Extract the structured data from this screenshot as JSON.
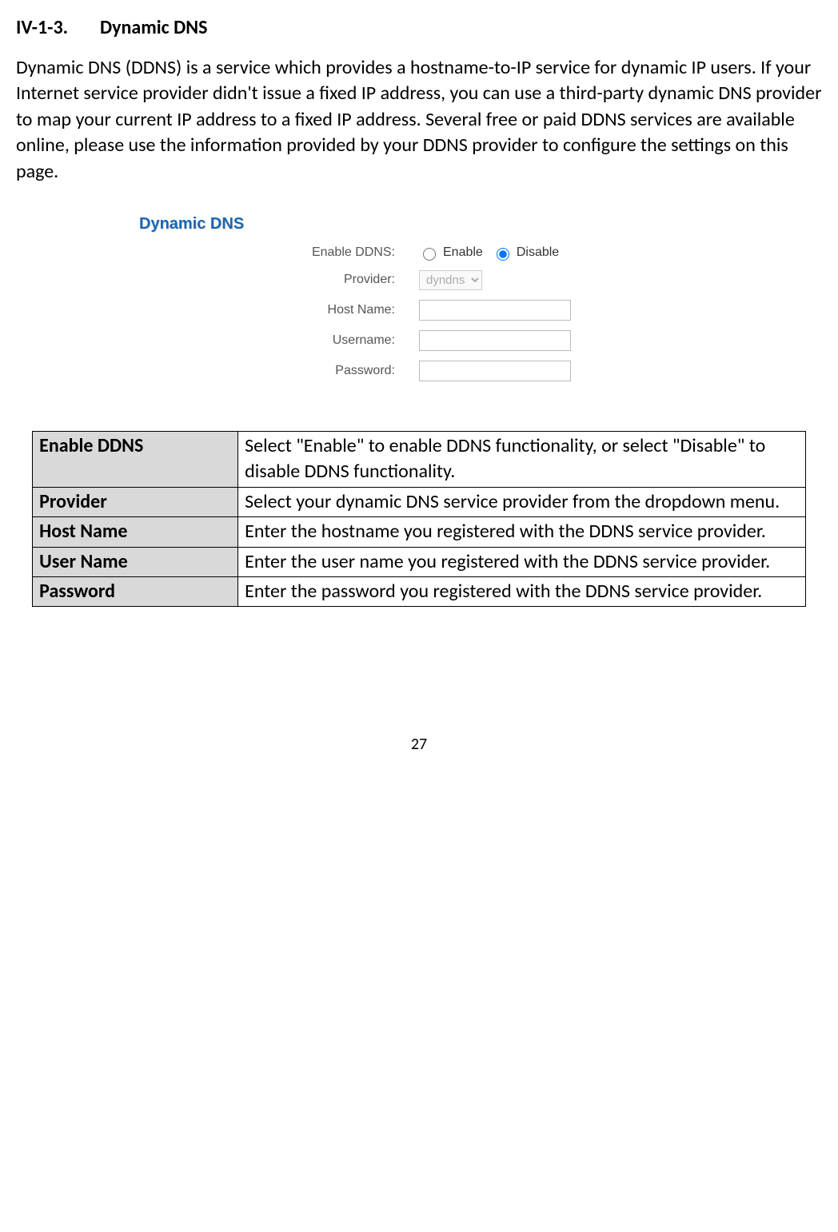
{
  "heading": {
    "number": "IV-1-3.",
    "title": "Dynamic DNS"
  },
  "intro": "Dynamic DNS (DDNS) is a service which provides a hostname-to-IP service for dynamic IP users. If your Internet service provider didn't issue a fixed IP address, you can use a third-party dynamic DNS provider to map your current IP address to a fixed IP address. Several free or paid DDNS services are available online, please use the information provided by your DDNS provider to configure the settings on this page.",
  "form": {
    "title": "Dynamic DNS",
    "labels": {
      "enable": "Enable DDNS:",
      "provider": "Provider:",
      "hostname": "Host Name:",
      "username": "Username:",
      "password": "Password:"
    },
    "radio": {
      "enable": "Enable",
      "disable": "Disable"
    },
    "provider_value": "dyndns"
  },
  "table": {
    "rows": [
      {
        "key": "Enable DDNS",
        "desc": "Select \"Enable\" to enable DDNS functionality, or select \"Disable\" to disable DDNS functionality."
      },
      {
        "key": "Provider",
        "desc": "Select your dynamic DNS service provider from the dropdown menu."
      },
      {
        "key": "Host Name",
        "desc": "Enter the hostname you registered with the DDNS service provider."
      },
      {
        "key": "User Name",
        "desc": "Enter the user name you registered with the DDNS service provider."
      },
      {
        "key": "Password",
        "desc": "Enter the password you registered with the DDNS service provider."
      }
    ]
  },
  "page_number": "27"
}
